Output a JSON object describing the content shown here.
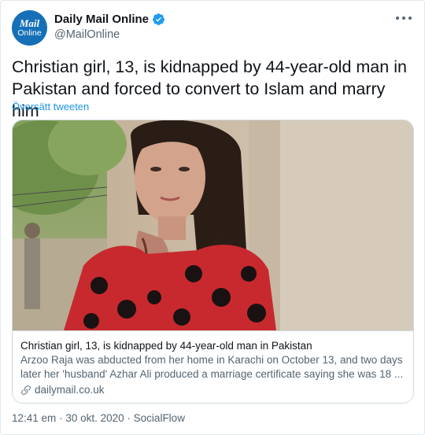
{
  "account": {
    "display_name": "Daily Mail Online",
    "handle": "@MailOnline",
    "avatar_text_line1": "Mail",
    "avatar_text_line2": "Online",
    "verified": true,
    "avatar_color": "#1670b8",
    "verified_color": "#1d9bf0"
  },
  "tweet": {
    "text": "Christian girl, 13, is kidnapped by 44-year-old man in Pakistan and forced to convert to Islam and marry him",
    "translate_label": "Översätt tweeten"
  },
  "card": {
    "image_icon": "photo-girl-portrait",
    "title": "Christian girl, 13, is kidnapped by 44-year-old man in Pakistan",
    "description": "Arzoo Raja was abducted from her home in Karachi on October 13, and two days later her 'husband' Azhar Ali produced a marriage certificate saying she was 18 ...",
    "domain": "dailymail.co.uk",
    "domain_icon": "link-icon"
  },
  "footer": {
    "time": "12:41 em",
    "separator1": "·",
    "date": "30 okt. 2020",
    "separator2": "·",
    "source": "SocialFlow"
  },
  "colors": {
    "link": "#1b95e0",
    "secondary_text": "#536471",
    "border": "#cfd9de"
  }
}
